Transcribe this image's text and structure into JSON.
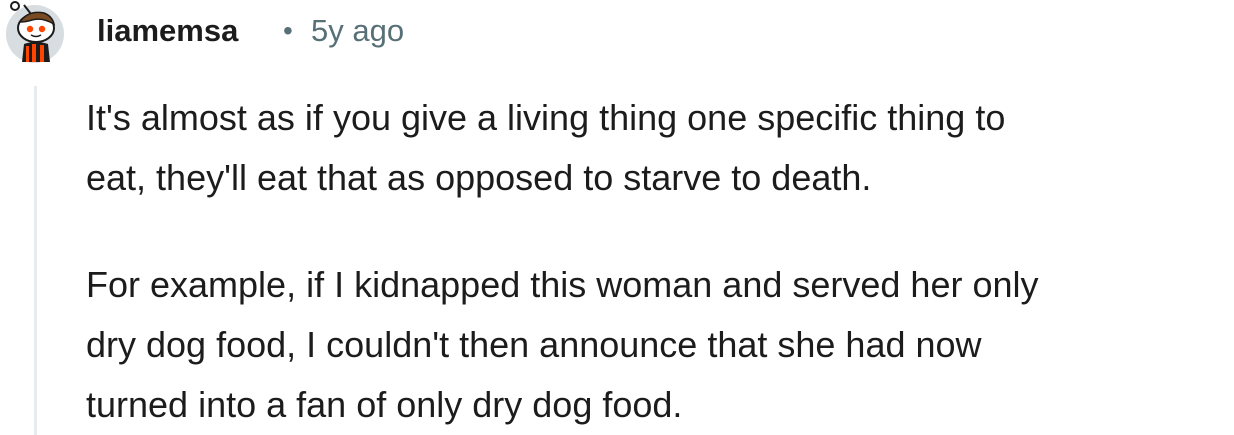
{
  "comment": {
    "author": "liamemsa",
    "separator": "•",
    "timestamp": "5y ago",
    "avatar_icon": "reddit-snoo-avatar-icon",
    "paragraphs": [
      "It's almost as if you give a living thing one specific thing to\neat, they'll eat that as opposed to starve to death.",
      "For example, if I kidnapped this woman and served her only\ndry dog food, I couldn't then announce that she had now\nturned into a fan of only dry dog food."
    ]
  },
  "colors": {
    "text": "#1c1c1c",
    "meta": "#576f76",
    "thread_line": "#e5ebee",
    "avatar_accent": "#ff4500"
  }
}
